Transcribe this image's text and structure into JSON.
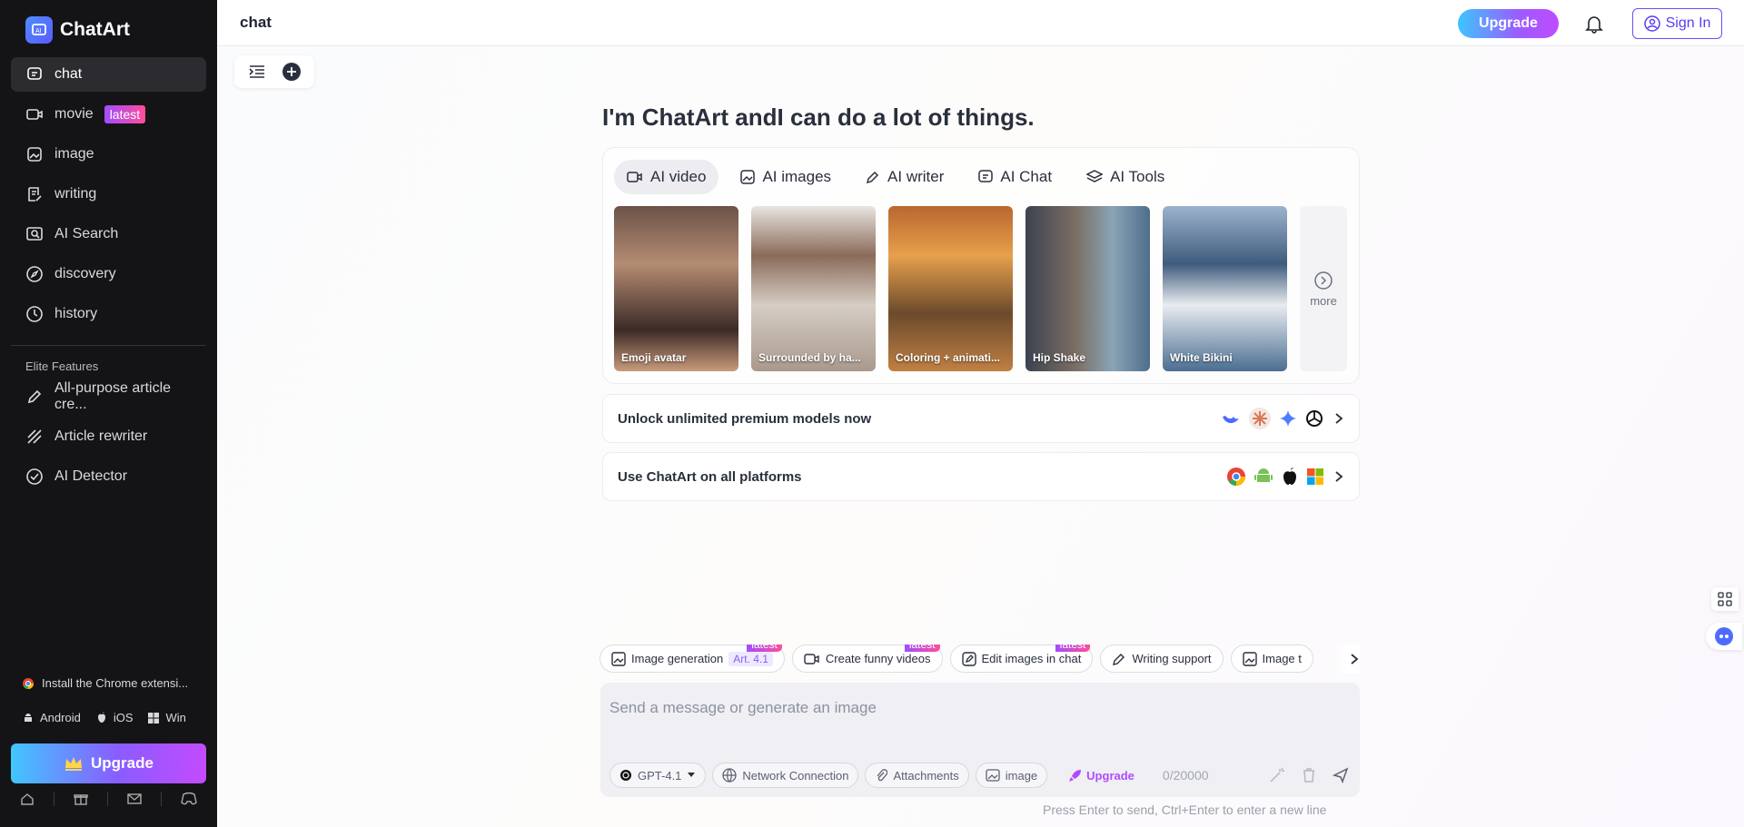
{
  "brand": {
    "name": "ChatArt"
  },
  "sidebar": {
    "items": [
      {
        "label": "chat",
        "icon": "chat-icon",
        "active": true
      },
      {
        "label": "movie",
        "icon": "video-icon",
        "badge": "latest"
      },
      {
        "label": "image",
        "icon": "image-icon"
      },
      {
        "label": "writing",
        "icon": "writing-icon"
      },
      {
        "label": "AI Search",
        "icon": "search-icon"
      },
      {
        "label": "discovery",
        "icon": "compass-icon"
      },
      {
        "label": "history",
        "icon": "history-icon"
      }
    ],
    "elite_label": "Elite Features",
    "elite_items": [
      {
        "label": "All-purpose article cre...",
        "icon": "pen-icon"
      },
      {
        "label": "Article rewriter",
        "icon": "rewrite-icon"
      },
      {
        "label": "AI Detector",
        "icon": "check-circle-icon"
      }
    ],
    "extension": "Install the Chrome extensi...",
    "platforms": [
      "Android",
      "iOS",
      "Win"
    ],
    "upgrade": "Upgrade"
  },
  "topbar": {
    "title": "chat",
    "upgrade": "Upgrade",
    "signin": "Sign In"
  },
  "main": {
    "headline": "I'm ChatArt andI can do a lot of things.",
    "tabs": [
      {
        "label": "AI video",
        "active": true
      },
      {
        "label": "AI images"
      },
      {
        "label": "AI writer"
      },
      {
        "label": "AI Chat"
      },
      {
        "label": "AI Tools"
      }
    ],
    "thumbs": [
      {
        "caption": "Emoji avatar"
      },
      {
        "caption": "Surrounded by ha..."
      },
      {
        "caption": "Coloring + animati..."
      },
      {
        "caption": "Hip Shake"
      },
      {
        "caption": "White Bikini"
      }
    ],
    "more": "more",
    "premium": "Unlock unlimited premium models now",
    "platforms_row": "Use ChatArt on all platforms",
    "chips": [
      {
        "label": "Image generation",
        "tag": "latest",
        "extra": "Art. 4.1"
      },
      {
        "label": "Create funny videos",
        "tag": "latest"
      },
      {
        "label": "Edit images in chat",
        "tag": "latest"
      },
      {
        "label": "Writing support"
      },
      {
        "label": "Image t"
      }
    ],
    "composer": {
      "placeholder": "Send a message or generate an image",
      "model": "GPT-4.1",
      "network": "Network Connection",
      "attachments": "Attachments",
      "image": "image",
      "upgrade": "Upgrade",
      "count": "0/20000"
    },
    "hint": "Press Enter to send, Ctrl+Enter to enter a new line"
  },
  "colors": {
    "accent": "#7b4dff",
    "sidebar_bg": "#141416"
  }
}
